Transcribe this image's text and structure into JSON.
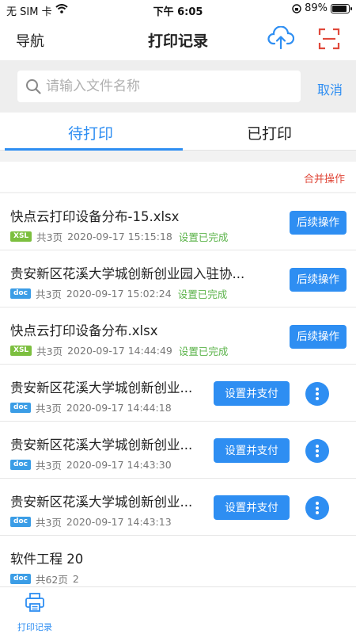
{
  "status_bar": {
    "carrier": "无 SIM 卡",
    "time": "下午 6:05",
    "battery": "89%",
    "battery_level": 0.89
  },
  "nav": {
    "back_label": "导航",
    "title": "打印记录",
    "upload_icon": "cloud-upload-icon",
    "scan_icon": "scan-icon"
  },
  "search": {
    "placeholder": "请输入文件名称",
    "value": "",
    "cancel_label": "取消"
  },
  "tabs": [
    {
      "label": "待打印",
      "active": true
    },
    {
      "label": "已打印",
      "active": false
    }
  ],
  "merge_label": "合并操作",
  "items": [
    {
      "name": "快点云打印设备分布-15.xlsx",
      "type": "XSL",
      "pages": "共3页",
      "time": "2020-09-17 15:15:18",
      "status": "设置已完成",
      "action": "后续操作"
    },
    {
      "name": "贵安新区花溪大学城创新创业园入驻协...",
      "type": "doc",
      "pages": "共3页",
      "time": "2020-09-17 15:02:24",
      "status": "设置已完成",
      "action": "后续操作"
    },
    {
      "name": "快点云打印设备分布.xlsx",
      "type": "XSL",
      "pages": "共3页",
      "time": "2020-09-17 14:44:49",
      "status": "设置已完成",
      "action": "后续操作"
    },
    {
      "name": "贵安新区花溪大学城创新创业...",
      "type": "doc",
      "pages": "共3页",
      "time": "2020-09-17 14:44:18",
      "status": "",
      "action": "设置并支付"
    },
    {
      "name": "贵安新区花溪大学城创新创业...",
      "type": "doc",
      "pages": "共3页",
      "time": "2020-09-17 14:43:30",
      "status": "",
      "action": "设置并支付"
    },
    {
      "name": "贵安新区花溪大学城创新创业...",
      "type": "doc",
      "pages": "共3页",
      "time": "2020-09-17 14:43:13",
      "status": "",
      "action": "设置并支付"
    },
    {
      "name": "软件工程 20",
      "type": "doc",
      "pages": "共62页",
      "time": "2",
      "status": "",
      "action": ""
    }
  ],
  "tab_bar": {
    "label": "打印记录",
    "icon": "printer-icon"
  },
  "colors": {
    "accent": "#2e8ef2",
    "success": "#5bb34a",
    "danger": "#e0493b",
    "xsl_badge": "#7cbf3f",
    "doc_badge": "#3b9de6"
  }
}
